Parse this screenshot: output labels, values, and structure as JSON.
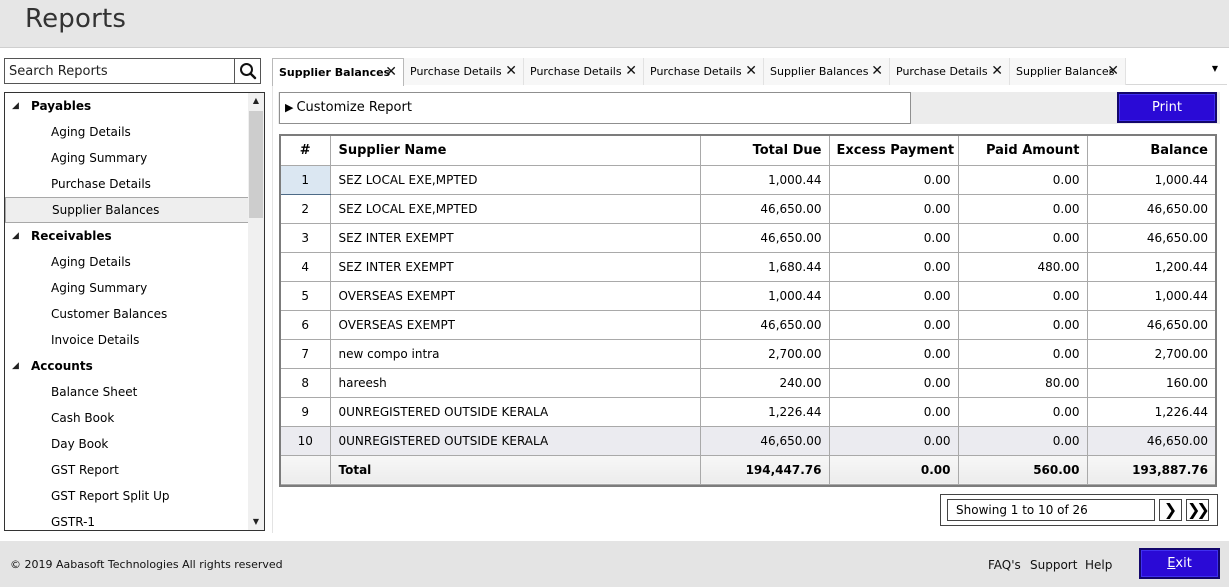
{
  "header": {
    "title": "Reports"
  },
  "sidebar": {
    "search_placeholder": "Search Reports",
    "groups": [
      {
        "label": "Payables",
        "items": [
          "Aging Details",
          "Aging Summary",
          "Purchase Details",
          "Supplier Balances"
        ]
      },
      {
        "label": "Receivables",
        "items": [
          "Aging Details",
          "Aging Summary",
          "Customer Balances",
          "Invoice Details"
        ]
      },
      {
        "label": "Accounts",
        "items": [
          "Balance Sheet",
          "Cash Book",
          "Day Book",
          "GST Report",
          "GST Report Split Up",
          "GSTR-1"
        ]
      }
    ],
    "selected_item": "Supplier Balances"
  },
  "tabs": [
    {
      "label": "Supplier Balances",
      "active": true
    },
    {
      "label": "Purchase Details",
      "active": false
    },
    {
      "label": "Purchase Details",
      "active": false
    },
    {
      "label": "Purchase Details",
      "active": false
    },
    {
      "label": "Supplier Balances",
      "active": false
    },
    {
      "label": "Purchase Details",
      "active": false
    },
    {
      "label": "Supplier Balances",
      "active": false
    }
  ],
  "toolbar": {
    "customize_label": "Customize Report",
    "print_label": "Print"
  },
  "table": {
    "columns": [
      "#",
      "Supplier Name",
      "Total Due",
      "Excess Payment",
      "Paid Amount",
      "Balance"
    ],
    "rows": [
      [
        "1",
        "SEZ LOCAL EXE,MPTED",
        "1,000.44",
        "0.00",
        "0.00",
        "1,000.44"
      ],
      [
        "2",
        "SEZ LOCAL EXE,MPTED",
        "46,650.00",
        "0.00",
        "0.00",
        "46,650.00"
      ],
      [
        "3",
        "SEZ INTER EXEMPT",
        "46,650.00",
        "0.00",
        "0.00",
        "46,650.00"
      ],
      [
        "4",
        "SEZ INTER EXEMPT",
        "1,680.44",
        "0.00",
        "480.00",
        "1,200.44"
      ],
      [
        "5",
        "OVERSEAS EXEMPT",
        "1,000.44",
        "0.00",
        "0.00",
        "1,000.44"
      ],
      [
        "6",
        "OVERSEAS EXEMPT",
        "46,650.00",
        "0.00",
        "0.00",
        "46,650.00"
      ],
      [
        "7",
        "new compo intra",
        "2,700.00",
        "0.00",
        "0.00",
        "2,700.00"
      ],
      [
        "8",
        "hareesh",
        "240.00",
        "0.00",
        "80.00",
        "160.00"
      ],
      [
        "9",
        "0UNREGISTERED OUTSIDE KERALA",
        "1,226.44",
        "0.00",
        "0.00",
        "1,226.44"
      ],
      [
        "10",
        "0UNREGISTERED OUTSIDE KERALA",
        "46,650.00",
        "0.00",
        "0.00",
        "46,650.00"
      ]
    ],
    "total": [
      "",
      "Total",
      "194,447.76",
      "0.00",
      "560.00",
      "193,887.76"
    ]
  },
  "pager": {
    "info": "Showing 1 to 10 of 26",
    "next_icon": "chevron-right",
    "last_icon": "double-chevron-right"
  },
  "footer": {
    "copyright": "© 2019 Aabasoft Technologies All rights reserved",
    "links": [
      "FAQ's",
      "Support",
      "Help"
    ],
    "exit_label_first": "E",
    "exit_label_rest": "xit"
  },
  "colors": {
    "accent_button": "#2a0ad6",
    "header_bg": "#e6e6e6"
  }
}
